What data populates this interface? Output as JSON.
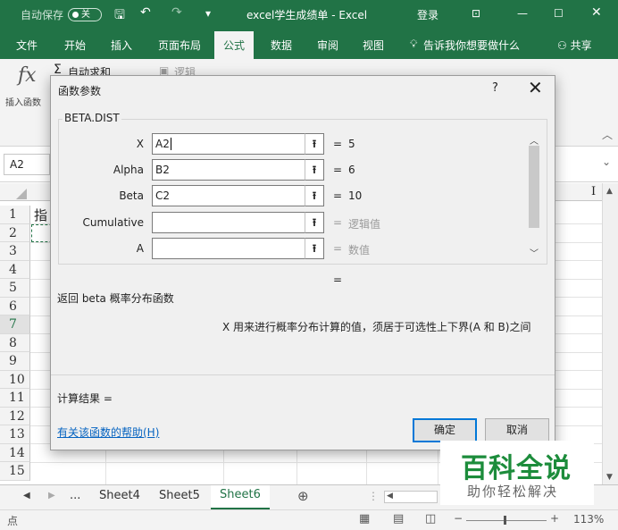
{
  "titlebar": {
    "autosave_label": "自动保存",
    "autosave_state": "关",
    "doc_title": "excel学生成绩单 - Excel",
    "signin": "登录"
  },
  "ribbon_tabs": [
    "文件",
    "开始",
    "插入",
    "页面布局",
    "公式",
    "数据",
    "审阅",
    "视图"
  ],
  "active_tab": "公式",
  "tell_me": "告诉我你想要做什么",
  "share": "共享",
  "ribbon": {
    "insert_function_icon": "fx",
    "insert_function_label": "插入函数",
    "autosum_label": "自动求和",
    "logical_label": "逻辑"
  },
  "namebox": "A2",
  "grid": {
    "row_numbers": [
      "1",
      "2",
      "3",
      "4",
      "5",
      "6",
      "7",
      "8",
      "9",
      "10",
      "11",
      "12",
      "13",
      "14",
      "15"
    ],
    "cell_a1": "指",
    "column_hint": "I"
  },
  "dialog": {
    "title": "函数参数",
    "help_char": "?",
    "function_name": "BETA.DIST",
    "args": [
      {
        "label": "X",
        "value": "A2",
        "result": "5",
        "hint": false
      },
      {
        "label": "Alpha",
        "value": "B2",
        "result": "6",
        "hint": false
      },
      {
        "label": "Beta",
        "value": "C2",
        "result": "10",
        "hint": false
      },
      {
        "label": "Cumulative",
        "value": "",
        "result": "逻辑值",
        "hint": true
      },
      {
        "label": "A",
        "value": "",
        "result": "数值",
        "hint": true
      }
    ],
    "equals_sign": "=",
    "description": "返回 beta 概率分布函数",
    "arg_help": "X  用来进行概率分布计算的值，须居于可选性上下界(A 和 B)之间",
    "result_label": "计算结果 =",
    "help_link": "有关该函数的帮助(H)",
    "ok_label": "确定",
    "cancel_label": "取消"
  },
  "sheet_tabs": {
    "ellipsis": "...",
    "items": [
      "Sheet4",
      "Sheet5",
      "Sheet6"
    ],
    "active": "Sheet6"
  },
  "status": {
    "mode": "点",
    "zoom": "113%"
  },
  "watermark": {
    "line1": "百科全说",
    "line2": "助你轻松解决"
  },
  "colors": {
    "excel_green": "#217346",
    "dialog_bg": "#f0f0f0",
    "link_blue": "#0563c1",
    "primary_border": "#0078d7"
  }
}
